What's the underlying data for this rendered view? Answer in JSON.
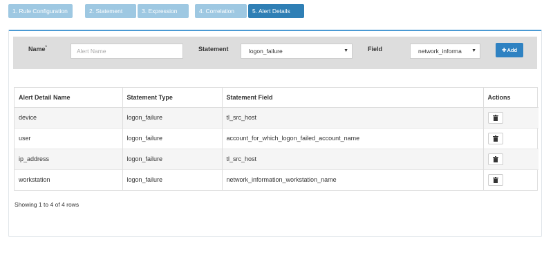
{
  "steps": [
    {
      "label": "1. Rule Configuration",
      "active": false
    },
    {
      "label": "2. Statement",
      "active": false
    },
    {
      "label": "3. Expression",
      "active": false
    },
    {
      "label": "4. Correlation",
      "active": false
    },
    {
      "label": "5. Alert Details",
      "active": true
    }
  ],
  "form": {
    "name_label": "Name",
    "required_mark": "*",
    "name_placeholder": "Alert Name",
    "name_value": "",
    "statement_label": "Statement",
    "statement_value": "logon_failure",
    "field_label": "Field",
    "field_value": "network_informa",
    "add_label": "Add",
    "add_icon": "plus-icon"
  },
  "table": {
    "headers": [
      "Alert Detail Name",
      "Statement Type",
      "Statement Field",
      "Actions"
    ],
    "rows": [
      {
        "name": "device",
        "type": "logon_failure",
        "field": "tl_src_host"
      },
      {
        "name": "user",
        "type": "logon_failure",
        "field": "account_for_which_logon_failed_account_name"
      },
      {
        "name": "ip_address",
        "type": "logon_failure",
        "field": "tl_src_host"
      },
      {
        "name": "workstation",
        "type": "logon_failure",
        "field": "network_information_workstation_name"
      }
    ],
    "action_icon": "trash-icon"
  },
  "footer": "Showing 1 to 4 of 4 rows",
  "colors": {
    "step_inactive": "#9ec8e2",
    "step_active": "#2f7fb5",
    "panel_accent": "#4a9ad4",
    "add_button": "#2f82c2",
    "form_bar": "#dddddd"
  }
}
